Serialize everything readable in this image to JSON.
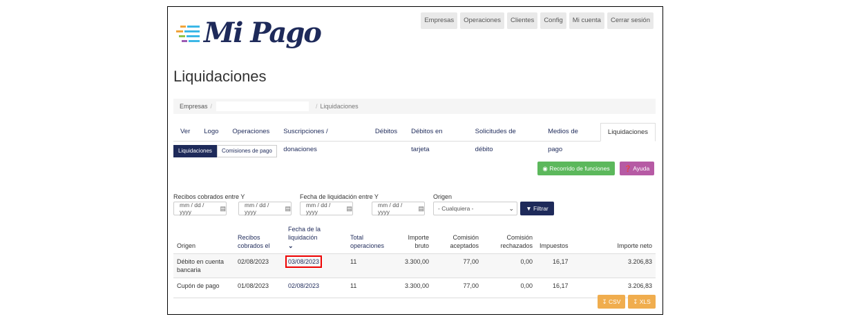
{
  "logo": {
    "text": "Mi Pago"
  },
  "topnav": [
    "Empresas",
    "Operaciones",
    "Clientes",
    "Config",
    "Mi cuenta",
    "Cerrar sesión"
  ],
  "page_title": "Liquidaciones",
  "breadcrumb": {
    "root": "Empresas",
    "current": "Liquidaciones"
  },
  "tabs": [
    "Ver",
    "Logo",
    "Operaciones",
    "Suscripciones / donaciones",
    "Débitos",
    "Débitos en tarjeta",
    "Solicitudes de débito",
    "Medios de pago",
    "Liquidaciones"
  ],
  "subtabs": [
    "Liquidaciones",
    "Comisiones de pago"
  ],
  "buttons": {
    "tour": "Recorrido de funciones",
    "help": "Ayuda",
    "filter": "Filtrar",
    "csv": "CSV",
    "xls": "XLS"
  },
  "filters": {
    "recibos_label": "Recibos cobrados entre Y",
    "fecha_label": "Fecha de liquidación entre Y",
    "origen_label": "Origen",
    "date_placeholder": "mm / dd / yyyy",
    "origen_value": "- Cualquiera -"
  },
  "table": {
    "headers": {
      "origen": "Origen",
      "recibos": "Recibos cobrados el",
      "fecha": "Fecha de la liquidación",
      "total": "Total operaciones",
      "bruto": "Importe bruto",
      "com_acept": "Comisión aceptados",
      "com_rech": "Comisión rechazados",
      "impuestos": "Impuestos",
      "neto": "Importe neto"
    },
    "rows": [
      {
        "origen": "Débito en cuenta bancaria",
        "recibos": "02/08/2023",
        "fecha": "03/08/2023",
        "total": "11",
        "bruto": "3.300,00",
        "com_acept": "77,00",
        "com_rech": "0,00",
        "impuestos": "16,17",
        "neto": "3.206,83"
      },
      {
        "origen": "Cupón de pago",
        "recibos": "01/08/2023",
        "fecha": "02/08/2023",
        "total": "11",
        "bruto": "3.300,00",
        "com_acept": "77,00",
        "com_rech": "0,00",
        "impuestos": "16,17",
        "neto": "3.206,83"
      }
    ]
  },
  "colors": {
    "navy": "#1e2a5a",
    "green": "#5cb85c",
    "purple": "#b65aa4",
    "orange": "#f0ad4e",
    "highlight": "#e00000"
  }
}
